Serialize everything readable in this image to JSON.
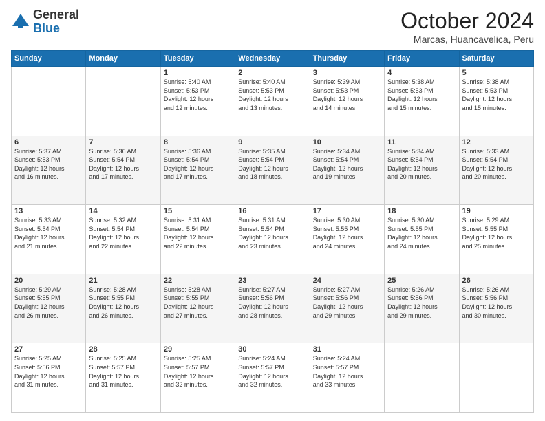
{
  "logo": {
    "general": "General",
    "blue": "Blue"
  },
  "title": "October 2024",
  "location": "Marcas, Huancavelica, Peru",
  "days": [
    "Sunday",
    "Monday",
    "Tuesday",
    "Wednesday",
    "Thursday",
    "Friday",
    "Saturday"
  ],
  "rows": [
    [
      {
        "date": "",
        "info": ""
      },
      {
        "date": "",
        "info": ""
      },
      {
        "date": "1",
        "info": "Sunrise: 5:40 AM\nSunset: 5:53 PM\nDaylight: 12 hours\nand 12 minutes."
      },
      {
        "date": "2",
        "info": "Sunrise: 5:40 AM\nSunset: 5:53 PM\nDaylight: 12 hours\nand 13 minutes."
      },
      {
        "date": "3",
        "info": "Sunrise: 5:39 AM\nSunset: 5:53 PM\nDaylight: 12 hours\nand 14 minutes."
      },
      {
        "date": "4",
        "info": "Sunrise: 5:38 AM\nSunset: 5:53 PM\nDaylight: 12 hours\nand 15 minutes."
      },
      {
        "date": "5",
        "info": "Sunrise: 5:38 AM\nSunset: 5:53 PM\nDaylight: 12 hours\nand 15 minutes."
      }
    ],
    [
      {
        "date": "6",
        "info": "Sunrise: 5:37 AM\nSunset: 5:53 PM\nDaylight: 12 hours\nand 16 minutes."
      },
      {
        "date": "7",
        "info": "Sunrise: 5:36 AM\nSunset: 5:54 PM\nDaylight: 12 hours\nand 17 minutes."
      },
      {
        "date": "8",
        "info": "Sunrise: 5:36 AM\nSunset: 5:54 PM\nDaylight: 12 hours\nand 17 minutes."
      },
      {
        "date": "9",
        "info": "Sunrise: 5:35 AM\nSunset: 5:54 PM\nDaylight: 12 hours\nand 18 minutes."
      },
      {
        "date": "10",
        "info": "Sunrise: 5:34 AM\nSunset: 5:54 PM\nDaylight: 12 hours\nand 19 minutes."
      },
      {
        "date": "11",
        "info": "Sunrise: 5:34 AM\nSunset: 5:54 PM\nDaylight: 12 hours\nand 20 minutes."
      },
      {
        "date": "12",
        "info": "Sunrise: 5:33 AM\nSunset: 5:54 PM\nDaylight: 12 hours\nand 20 minutes."
      }
    ],
    [
      {
        "date": "13",
        "info": "Sunrise: 5:33 AM\nSunset: 5:54 PM\nDaylight: 12 hours\nand 21 minutes."
      },
      {
        "date": "14",
        "info": "Sunrise: 5:32 AM\nSunset: 5:54 PM\nDaylight: 12 hours\nand 22 minutes."
      },
      {
        "date": "15",
        "info": "Sunrise: 5:31 AM\nSunset: 5:54 PM\nDaylight: 12 hours\nand 22 minutes."
      },
      {
        "date": "16",
        "info": "Sunrise: 5:31 AM\nSunset: 5:54 PM\nDaylight: 12 hours\nand 23 minutes."
      },
      {
        "date": "17",
        "info": "Sunrise: 5:30 AM\nSunset: 5:55 PM\nDaylight: 12 hours\nand 24 minutes."
      },
      {
        "date": "18",
        "info": "Sunrise: 5:30 AM\nSunset: 5:55 PM\nDaylight: 12 hours\nand 24 minutes."
      },
      {
        "date": "19",
        "info": "Sunrise: 5:29 AM\nSunset: 5:55 PM\nDaylight: 12 hours\nand 25 minutes."
      }
    ],
    [
      {
        "date": "20",
        "info": "Sunrise: 5:29 AM\nSunset: 5:55 PM\nDaylight: 12 hours\nand 26 minutes."
      },
      {
        "date": "21",
        "info": "Sunrise: 5:28 AM\nSunset: 5:55 PM\nDaylight: 12 hours\nand 26 minutes."
      },
      {
        "date": "22",
        "info": "Sunrise: 5:28 AM\nSunset: 5:55 PM\nDaylight: 12 hours\nand 27 minutes."
      },
      {
        "date": "23",
        "info": "Sunrise: 5:27 AM\nSunset: 5:56 PM\nDaylight: 12 hours\nand 28 minutes."
      },
      {
        "date": "24",
        "info": "Sunrise: 5:27 AM\nSunset: 5:56 PM\nDaylight: 12 hours\nand 29 minutes."
      },
      {
        "date": "25",
        "info": "Sunrise: 5:26 AM\nSunset: 5:56 PM\nDaylight: 12 hours\nand 29 minutes."
      },
      {
        "date": "26",
        "info": "Sunrise: 5:26 AM\nSunset: 5:56 PM\nDaylight: 12 hours\nand 30 minutes."
      }
    ],
    [
      {
        "date": "27",
        "info": "Sunrise: 5:25 AM\nSunset: 5:56 PM\nDaylight: 12 hours\nand 31 minutes."
      },
      {
        "date": "28",
        "info": "Sunrise: 5:25 AM\nSunset: 5:57 PM\nDaylight: 12 hours\nand 31 minutes."
      },
      {
        "date": "29",
        "info": "Sunrise: 5:25 AM\nSunset: 5:57 PM\nDaylight: 12 hours\nand 32 minutes."
      },
      {
        "date": "30",
        "info": "Sunrise: 5:24 AM\nSunset: 5:57 PM\nDaylight: 12 hours\nand 32 minutes."
      },
      {
        "date": "31",
        "info": "Sunrise: 5:24 AM\nSunset: 5:57 PM\nDaylight: 12 hours\nand 33 minutes."
      },
      {
        "date": "",
        "info": ""
      },
      {
        "date": "",
        "info": ""
      }
    ]
  ]
}
